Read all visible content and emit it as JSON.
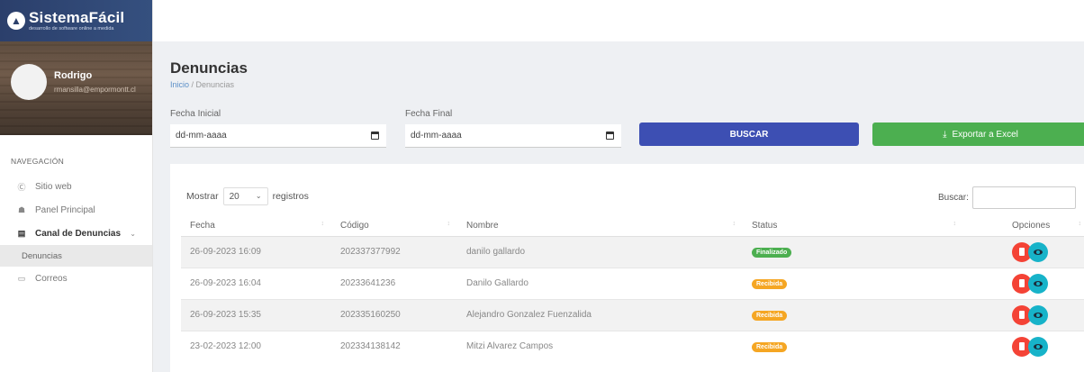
{
  "brand": {
    "name": "SistemaFácil",
    "tagline": "desarrollo de software online a medida",
    "color": "#2b3f6b"
  },
  "user": {
    "name": "Rodrigo",
    "email": "rmansilla@empormontt.cl"
  },
  "nav": {
    "heading": "NAVEGACIÓN",
    "items": [
      {
        "label": "Sitio web",
        "icon": "globe-icon"
      },
      {
        "label": "Panel Principal",
        "icon": "home-icon"
      },
      {
        "label": "Canal de Denuncias",
        "icon": "box-icon"
      },
      {
        "label": "Correos",
        "icon": "inbox-icon"
      }
    ],
    "sub_item": "Denuncias"
  },
  "page": {
    "title": "Denuncias",
    "breadcrumb_home": "Inicio",
    "breadcrumb_current": "/ Denuncias"
  },
  "filters": {
    "start_label": "Fecha Inicial",
    "start_placeholder": "dd-mm-aaaa",
    "end_label": "Fecha Final",
    "end_placeholder": "dd-mm-aaaa",
    "search_button": "BUSCAR",
    "export_button": "Exportar a Excel",
    "buscar_color": "#3d4fb3",
    "export_color": "#4caf50"
  },
  "table": {
    "show_prefix": "Mostrar",
    "show_value": "20",
    "show_suffix": "registros",
    "search_label": "Buscar:",
    "headers": [
      "Fecha",
      "Código",
      "Nombre",
      "Status",
      "Opciones"
    ],
    "rows": [
      {
        "fecha": "26-09-2023 16:09",
        "codigo": "202337377992",
        "nombre": "danilo gallardo",
        "status": "Finalizado",
        "status_color": "#4caf50"
      },
      {
        "fecha": "26-09-2023 16:04",
        "codigo": "20233641236",
        "nombre": "Danilo Gallardo",
        "status": "Recibida",
        "status_color": "#f5a623"
      },
      {
        "fecha": "26-09-2023 15:35",
        "codigo": "202335160250",
        "nombre": "Alejandro Gonzalez Fuenzalida",
        "status": "Recibida",
        "status_color": "#f5a623"
      },
      {
        "fecha": "23-02-2023 12:00",
        "codigo": "202334138142",
        "nombre": "Mitzi Alvarez Campos",
        "status": "Recibida",
        "status_color": "#f5a623"
      }
    ]
  }
}
